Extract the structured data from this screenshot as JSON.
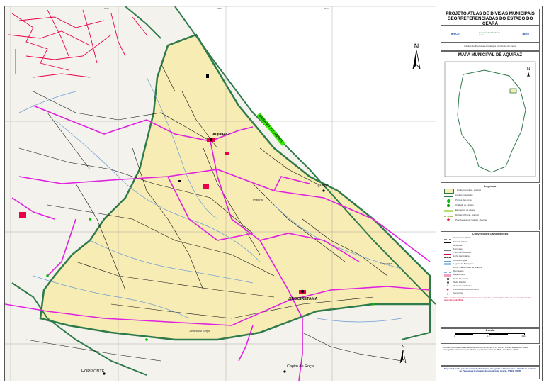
{
  "header": {
    "title_line1": "PROJETO ATLAS DE DIVISAS MUNICIPAIS",
    "title_line2": "GEORREFERENCIADAS DO ESTADO DO CEARÁ",
    "logos": [
      "IPECE",
      "Governo do Estado do Ceará",
      "IBGE"
    ],
    "credits_text": "Instituto de Pesquisa e Estratégia Econômica do Ceará"
  },
  "map": {
    "north_label": "N",
    "ocean_label": "OCEANO ATLÂNTICO",
    "towns": [
      {
        "name": "AQUIRAZ"
      },
      {
        "name": "Iguape"
      },
      {
        "name": "JINDOIRETAMA"
      },
      {
        "name": "Capim de Roça"
      },
      {
        "name": "HORIZONTE"
      },
      {
        "name": "Caponga"
      },
      {
        "name": "Prainha"
      },
      {
        "name": "Justiniano Serpa"
      }
    ],
    "colors": {
      "municipality_fill": "#f6ecb4",
      "boundary": "#2f7a4a",
      "rivers": "#6c9bd6",
      "roads_primary": "#e020e0",
      "urban": "#e8004a",
      "roads_secondary": "#111111",
      "ocean_label_bg": "#38f000"
    }
  },
  "panel": {
    "map_title": "MAPA MUNICIPAL DE AQUIRAZ",
    "inset_north": "N",
    "legend_title": "Legenda",
    "legend_items": [
      {
        "label": "Limite municipal - Aquiraz",
        "color": "#2f7a4a",
        "type": "box"
      },
      {
        "label": "Limites municipais",
        "color": "#2f7a4a",
        "type": "line"
      },
      {
        "label": "Pontos de Limites",
        "color": "#00c000",
        "type": "dot"
      },
      {
        "label": "Unidade de Limites",
        "color": "#00a000",
        "type": "dot"
      },
      {
        "label": "Elementos de divisa",
        "color": "#b4e070",
        "type": "band"
      },
      {
        "label": "Divisas Pública - Aquiraz",
        "color": "#a8c060",
        "type": "dash"
      },
      {
        "label": "Posicionamento Satélite - Aquiraz",
        "color": "#e00030",
        "type": "cross"
      }
    ],
    "conventions_title": "Convenções Cartográficas",
    "conventions": [
      {
        "label": "Caminhos / Trilhas",
        "color": "#888888"
      },
      {
        "label": "Estrada Vicinal",
        "color": "#111111"
      },
      {
        "label": "Rodovias",
        "color": "#e020e0"
      },
      {
        "label": "Ferrovias",
        "color": "#7a7a7a"
      },
      {
        "label": "Trilho de Rodovias",
        "color": "#d00060"
      },
      {
        "label": "Linha Ferroviária",
        "color": "#444444"
      },
      {
        "label": "Cursos d'água",
        "color": "#6c9bd6"
      },
      {
        "label": "Lagoas de Barragens",
        "color": "#9cc4f0"
      },
      {
        "label": "Linha Transmissão de Energia",
        "color": "#a05050"
      },
      {
        "label": "Drenagens",
        "color": "#80b0e0"
      },
      {
        "label": "Área Urbana",
        "color": "#f0a0c0"
      },
      {
        "label": "Sede Municipal",
        "color": "#000000"
      },
      {
        "label": "Sede Distrital",
        "color": "#555555"
      },
      {
        "label": "Outras Localidades",
        "color": "#999999"
      },
      {
        "label": "Pontos de Posicionamento",
        "color": "#e00030"
      },
      {
        "label": "Aeroporto",
        "color": "#444444"
      }
    ],
    "red_note": "Obs.: As denominações constantes nas legendas e convenções referem-se ao mapeamento sistemático do IBGE.",
    "scale_title": "Escala",
    "scale_labels": [
      "0",
      "1,5",
      "3 km"
    ],
    "notes": "Divisas Municipais elaboradas de acordo com a Lei nº 12.956/97 e suas alterações. Base cartográfica elaborada pelo IPECE, a partir de cartas do IBGE, SUDENE e DSG.",
    "footer": "Mapa elaborado pela Gerência de Estatística, Geografia e Informações - GEGIN do Instituto de Pesquisa e Estratégia Econômica do Ceará - IPECE (2008)"
  }
}
